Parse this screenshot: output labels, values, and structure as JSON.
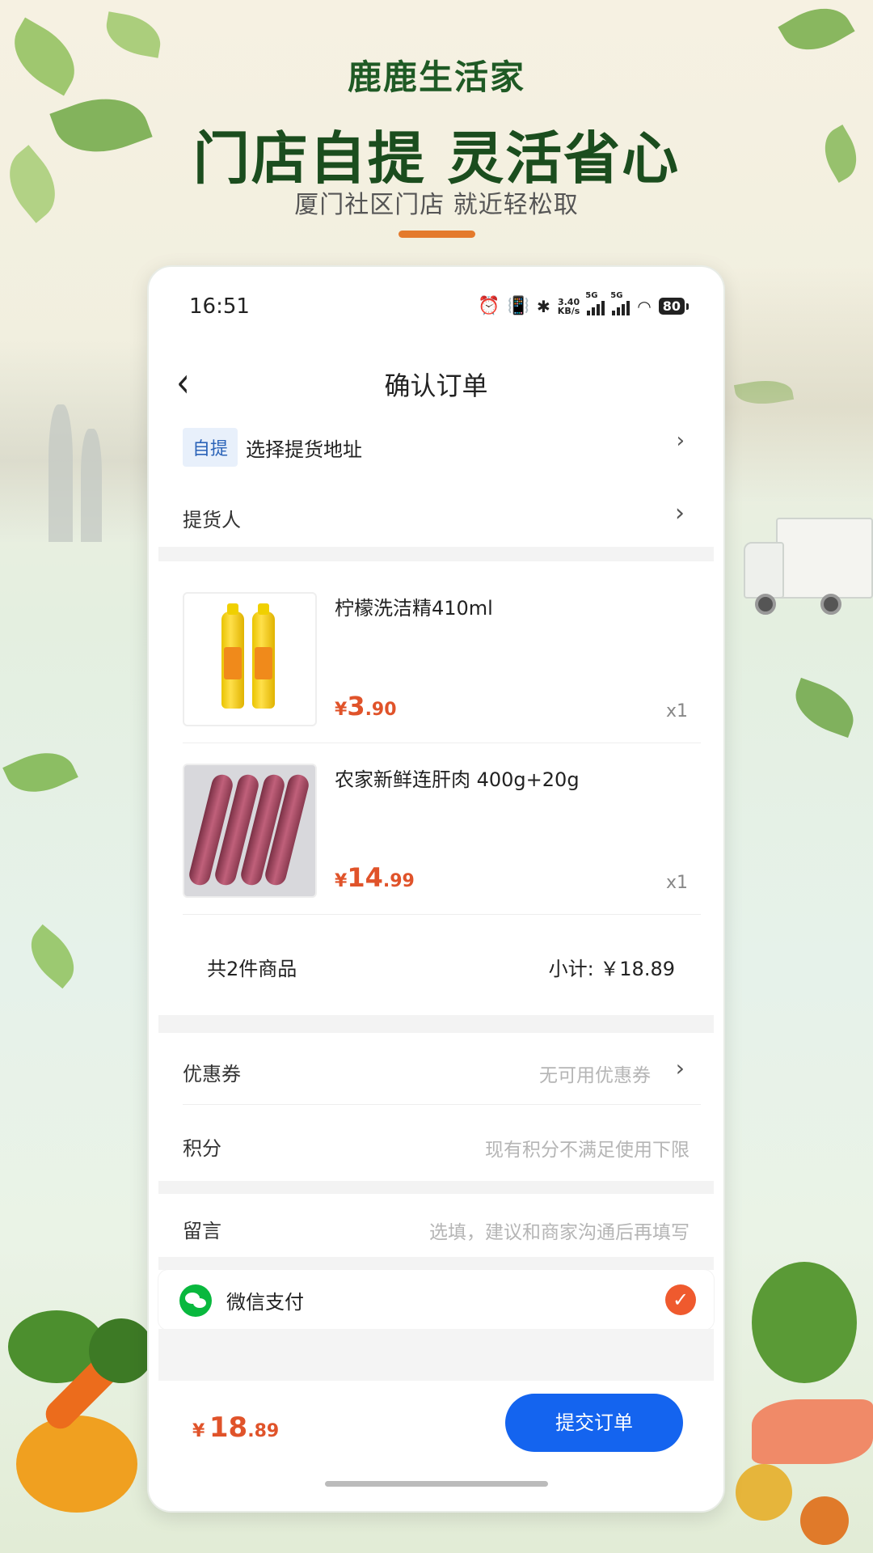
{
  "header": {
    "brand": "鹿鹿生活家",
    "headline": "门店自提 灵活省心",
    "subline": "厦门社区门店 就近轻松取"
  },
  "status_bar": {
    "time": "16:51",
    "speed_top": "3.40",
    "speed_bottom": "KB/s",
    "net1": "5G",
    "net2": "5G",
    "battery": "80"
  },
  "nav": {
    "title": "确认订单"
  },
  "pickup": {
    "tag": "自提",
    "address_label": "选择提货地址",
    "picker_label": "提货人"
  },
  "products": [
    {
      "name": "柠檬洗洁精410ml",
      "price_symbol": "¥",
      "price_int": "3",
      "price_dec": ".90",
      "qty": "x1",
      "image": "lemon-dish-soap-bottles"
    },
    {
      "name": "农家新鲜连肝肉 400g+20g",
      "price_symbol": "¥",
      "price_int": "14",
      "price_dec": ".99",
      "qty": "x1",
      "image": "pork-strips"
    }
  ],
  "summary": {
    "count": "共2件商品",
    "subtotal": "小计: ￥18.89"
  },
  "coupon": {
    "label": "优惠券",
    "value": "无可用优惠券"
  },
  "points": {
    "label": "积分",
    "value": "现有积分不满足使用下限"
  },
  "message": {
    "label": "留言",
    "placeholder": "选填，建议和商家沟通后再填写"
  },
  "payment": {
    "label": "微信支付",
    "selected": true
  },
  "footer": {
    "price_symbol": "¥",
    "price_int": "18",
    "price_dec": ".89",
    "submit_label": "提交订单"
  },
  "colors": {
    "accent_blue": "#1464ef",
    "price_red": "#e0532a",
    "brand_green": "#1f5a25",
    "wechat_green": "#09b83e"
  }
}
